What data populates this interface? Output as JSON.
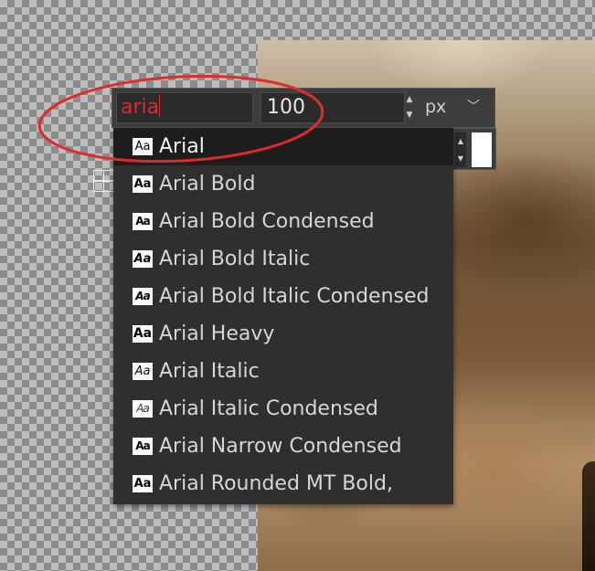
{
  "font_field": {
    "value": "aria"
  },
  "size_field": {
    "value": "100"
  },
  "unit_select": {
    "value": "px"
  },
  "font_list": [
    {
      "label": "Arial",
      "style": "normal",
      "selected": true
    },
    {
      "label": "Arial Bold",
      "style": "bold"
    },
    {
      "label": "Arial Bold Condensed",
      "style": "bold cond"
    },
    {
      "label": "Arial Bold Italic",
      "style": "bold italic"
    },
    {
      "label": "Arial Bold Italic Condensed",
      "style": "bold italic cond"
    },
    {
      "label": "Arial Heavy",
      "style": "heavy"
    },
    {
      "label": "Arial Italic",
      "style": "italic"
    },
    {
      "label": "Arial Italic Condensed",
      "style": "italic thin cond"
    },
    {
      "label": "Arial Narrow Condensed",
      "style": "bold cond"
    },
    {
      "label": "Arial Rounded MT Bold,",
      "style": "bold"
    }
  ],
  "font_preview_glyph": "Aa",
  "colors": {
    "annotation": "#e02b2b",
    "toolbar_bg": "#3d3d3d",
    "dropdown_bg": "#2f2f2f",
    "selected_bg": "#1d1d1d",
    "swatch": "#ffffff"
  },
  "icons": {
    "spin_up": "up-triangle-icon",
    "spin_down": "down-triangle-icon",
    "unit_chevron": "chevron-down-icon",
    "preview": "font-preview-icon",
    "move_handle": "move-handle-icon"
  }
}
